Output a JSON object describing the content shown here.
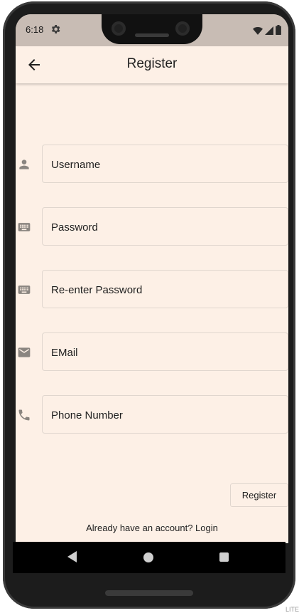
{
  "status_bar": {
    "time": "6:18",
    "icons": [
      "gear-icon",
      "wifi-icon",
      "signal-icon",
      "battery-icon"
    ]
  },
  "app_bar": {
    "title": "Register",
    "back_icon": "arrow-back-icon"
  },
  "form": {
    "fields": [
      {
        "placeholder": "Username",
        "value": "",
        "icon": "person-icon"
      },
      {
        "placeholder": "Password",
        "value": "",
        "icon": "keyboard-icon"
      },
      {
        "placeholder": "Re-enter Password",
        "value": "",
        "icon": "keyboard-icon"
      },
      {
        "placeholder": "EMail",
        "value": "",
        "icon": "email-icon"
      },
      {
        "placeholder": "Phone Number",
        "value": "",
        "icon": "phone-icon"
      }
    ],
    "register_label": "Register",
    "login_prompt": "Already have an account? Login"
  },
  "nav_bar": {
    "icons": [
      "nav-back-icon",
      "nav-home-icon",
      "nav-recents-icon"
    ]
  },
  "corner_label": "LITE",
  "colors": {
    "background": "#fdf0e6",
    "status_bar": "#c8bcb4",
    "icon_gray": "#8a8580",
    "text": "#1f1f1f"
  }
}
